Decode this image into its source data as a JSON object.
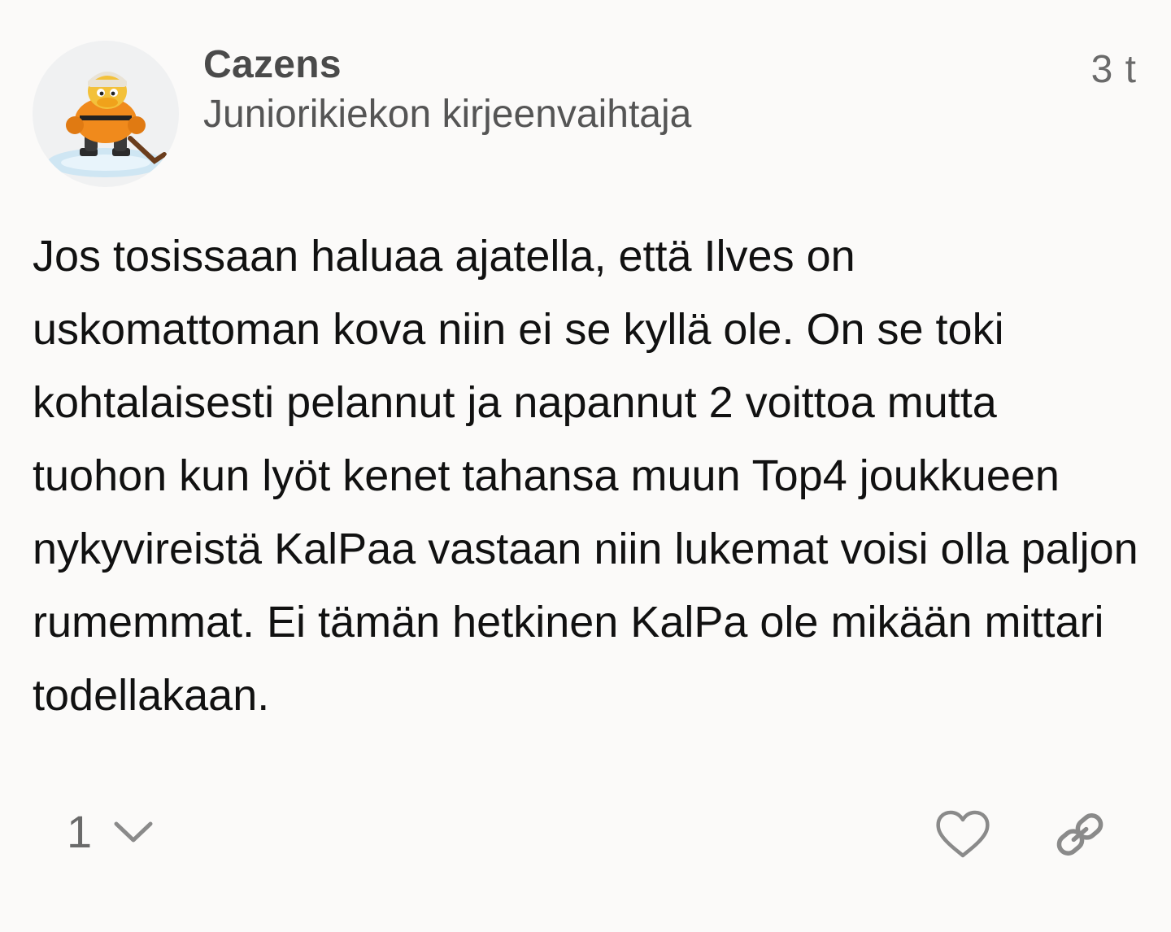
{
  "post": {
    "username": "Cazens",
    "user_title": "Juniorikiekon kirjeenvaihtaja",
    "date": "3 t",
    "body": "Jos tosissaan haluaa ajatella, että Ilves on uskomattoman kova niin ei se kyllä ole. On se toki kohtalaisesti pelannut ja napannut 2 voittoa mutta tuohon kun lyöt kenet tahansa muun Top4 joukkueen nykyvireistä KalPaa vastaan niin lukemat voisi olla paljon rumemmat. Ei tämän hetkinen KalPa ole mikään mittari todellakaan.",
    "reply_count": "1",
    "avatar_icon": "duck-hockey-player-avatar",
    "icons": {
      "replies_toggle": "chevron-down-icon",
      "like": "heart-icon",
      "share": "link-icon"
    },
    "colors": {
      "background": "#fbfaf9",
      "text": "#111111",
      "muted": "#6a6a6a",
      "avatar_accent": "#f08a1c"
    }
  }
}
